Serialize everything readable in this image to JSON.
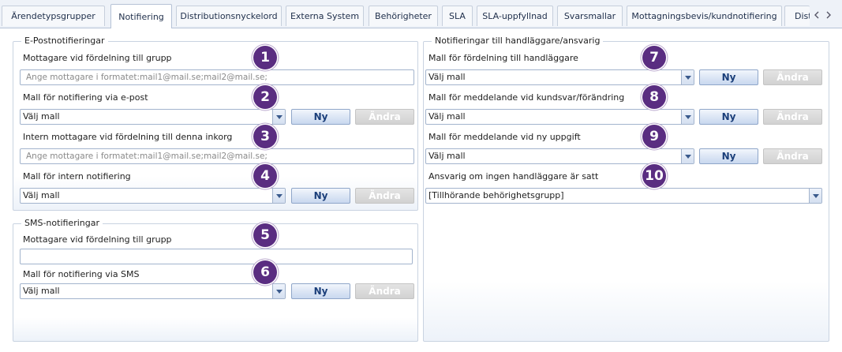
{
  "tabs": [
    {
      "label": "Ärendetypsgrupper"
    },
    {
      "label": "Notifiering"
    },
    {
      "label": "Distributionsnyckelord"
    },
    {
      "label": "Externa System"
    },
    {
      "label": "Behörigheter"
    },
    {
      "label": "SLA"
    },
    {
      "label": "SLA-uppfyllnad"
    },
    {
      "label": "Svarsmallar"
    },
    {
      "label": "Mottagningsbevis/kundnotifiering"
    },
    {
      "label": "Dist"
    }
  ],
  "active_tab": "Notifiering",
  "buttons": {
    "new": "Ny",
    "edit": "Ändra"
  },
  "email_group": {
    "title": "E-Postnotifieringar",
    "recipients_label": "Mottagare vid fördelning till grupp",
    "recipients_placeholder": "Ange mottagare i formatet:mail1@mail.se;mail2@mail.se;",
    "template_label": "Mall för notifiering via e-post",
    "template_value": "Välj mall",
    "internal_label": "Intern mottagare vid fördelning till denna inkorg",
    "internal_placeholder": "Ange mottagare i formatet:mail1@mail.se;mail2@mail.se;",
    "internal_template_label": "Mall för intern notifiering",
    "internal_template_value": "Välj mall"
  },
  "sms_group": {
    "title": "SMS-notifieringar",
    "recipients_label": "Mottagare vid fördelning till grupp",
    "recipients_value": "",
    "template_label": "Mall för notifiering via SMS",
    "template_value": "Välj mall"
  },
  "handler_group": {
    "title": "Notifieringar till handläggare/ansvarig",
    "assign_label": "Mall för fördelning till handläggare",
    "assign_value": "Välj mall",
    "reply_label": "Mall för meddelande vid kundsvar/förändring",
    "reply_value": "Välj mall",
    "task_label": "Mall för meddelande vid ny uppgift",
    "task_value": "Välj mall",
    "responsible_label": "Ansvarig om ingen handläggare är satt",
    "responsible_value": "[Tillhörande behörighetsgrupp]"
  },
  "badges": [
    "1",
    "2",
    "3",
    "4",
    "5",
    "6",
    "7",
    "8",
    "9",
    "10"
  ],
  "colors": {
    "badge": "#5a2d81",
    "button_text": "#1b3f7a",
    "accent_border": "#a3b4cd"
  },
  "icons": {
    "dropdown": "chevron-down-icon",
    "scroll_left": "triangle-left-icon",
    "scroll_right": "triangle-right-icon"
  }
}
